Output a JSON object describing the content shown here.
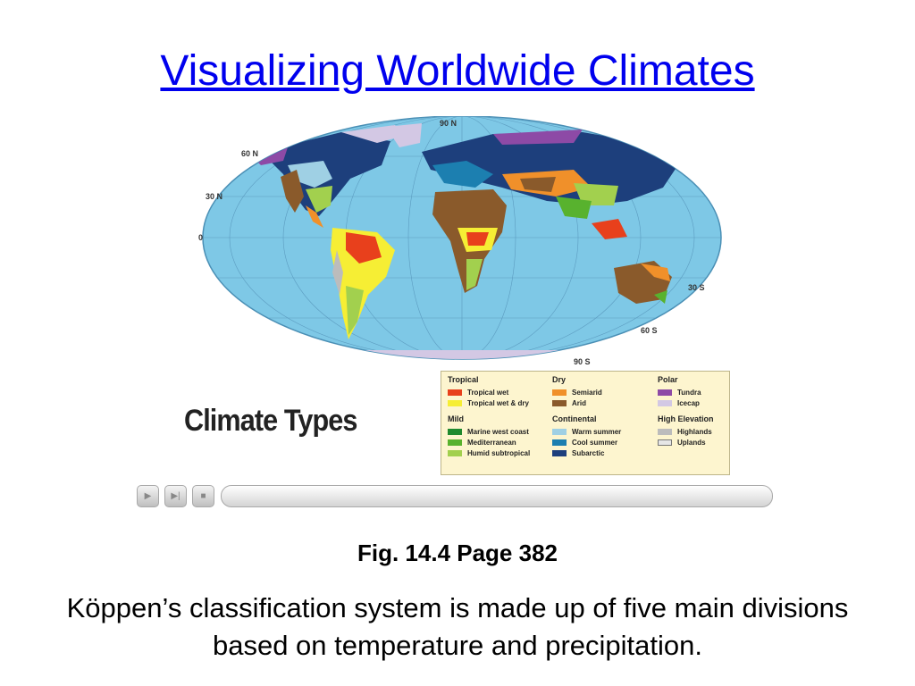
{
  "slide": {
    "title": "Visualizing Worldwide Climates",
    "figure_caption": "Fig. 14.4  Page 382",
    "body_text": "Köppen’s classification system is made up of five main divisions based on temperature and precipitation."
  },
  "map": {
    "latitude_labels": [
      "90 N",
      "60 N",
      "30 N",
      "0",
      "30 S",
      "60 S",
      "90 S"
    ]
  },
  "climate_heading": "Climate Types",
  "legend": {
    "tropical": {
      "title": "Tropical",
      "items": [
        {
          "label": "Tropical wet",
          "color": "#e8401c"
        },
        {
          "label": "Tropical wet & dry",
          "color": "#f6ee34"
        }
      ]
    },
    "mild": {
      "title": "Mild",
      "items": [
        {
          "label": "Marine west coast",
          "color": "#1f8a2f"
        },
        {
          "label": "Mediterranean",
          "color": "#58b22e"
        },
        {
          "label": "Humid subtropical",
          "color": "#a2d04e"
        }
      ]
    },
    "dry": {
      "title": "Dry",
      "items": [
        {
          "label": "Semiarid",
          "color": "#f0902a"
        },
        {
          "label": "Arid",
          "color": "#8a5a2b"
        }
      ]
    },
    "continental": {
      "title": "Continental",
      "items": [
        {
          "label": "Warm summer",
          "color": "#9fd0e4"
        },
        {
          "label": "Cool summer",
          "color": "#1c7fb0"
        },
        {
          "label": "Subarctic",
          "color": "#1d3f7c"
        }
      ]
    },
    "polar": {
      "title": "Polar",
      "items": [
        {
          "label": "Tundra",
          "color": "#8d4aa6"
        },
        {
          "label": "Icecap",
          "color": "#d3c8e4"
        }
      ]
    },
    "high_elevation": {
      "title": "High Elevation",
      "items": [
        {
          "label": "Highlands",
          "color": "#bcbcbc"
        },
        {
          "label": "Uplands",
          "color": "#e6e6e6"
        }
      ]
    }
  },
  "player": {
    "play_icon": "play-icon",
    "next_icon": "skip-forward-icon",
    "stop_icon": "stop-icon"
  }
}
